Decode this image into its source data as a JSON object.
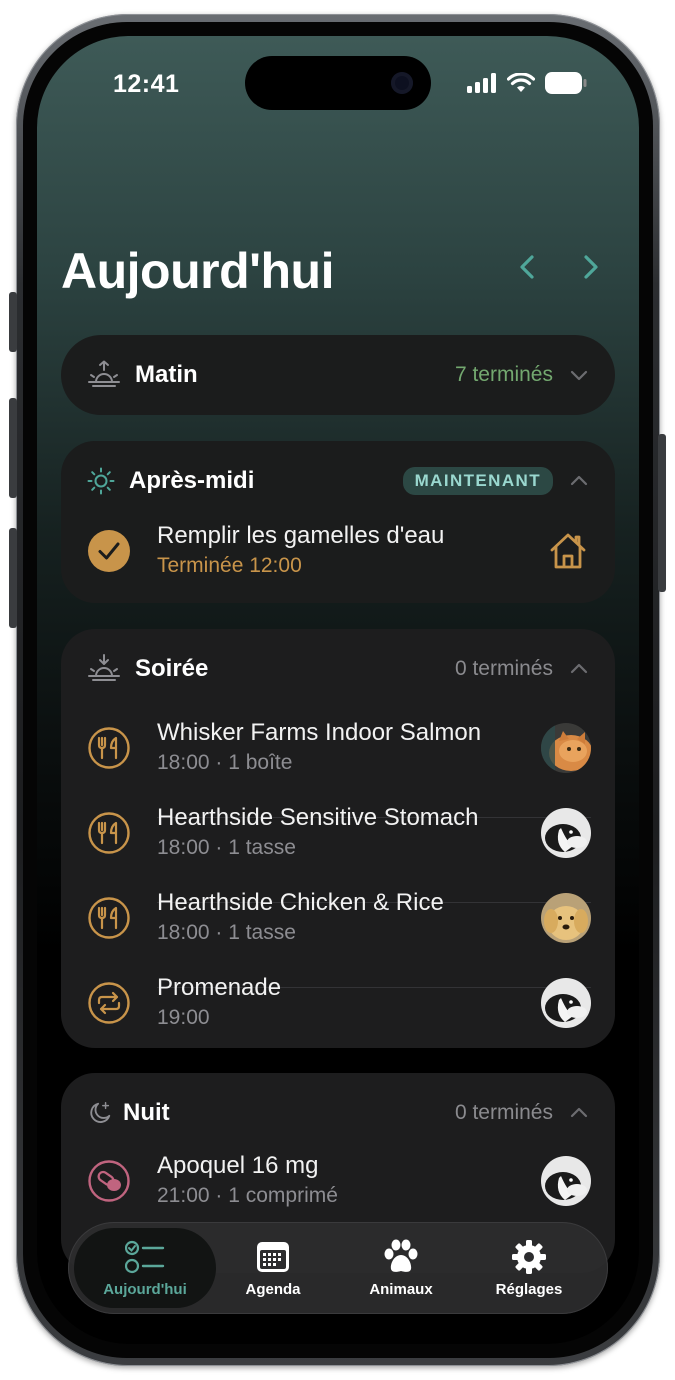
{
  "status_bar": {
    "time": "12:41"
  },
  "header": {
    "title": "Aujourd'hui"
  },
  "sections": {
    "matin": {
      "title": "Matin",
      "status": "7 terminés"
    },
    "aprem": {
      "title": "Après-midi",
      "badge": "MAINTENANT",
      "tasks": [
        {
          "title": "Remplir les gamelles d'eau",
          "subtitle": "Terminée 12:00"
        }
      ]
    },
    "soiree": {
      "title": "Soirée",
      "status": "0 terminés",
      "tasks": [
        {
          "title": "Whisker Farms Indoor Salmon",
          "subtitle": "18:00 · 1 boîte"
        },
        {
          "title": "Hearthside Sensitive Stomach",
          "subtitle": "18:00 · 1 tasse"
        },
        {
          "title": "Hearthside Chicken & Rice",
          "subtitle": "18:00 · 1 tasse"
        },
        {
          "title": "Promenade",
          "subtitle": "19:00"
        }
      ]
    },
    "nuit": {
      "title": "Nuit",
      "status": "0 terminés",
      "tasks": [
        {
          "title": "Apoquel 16 mg",
          "subtitle": "21:00 · 1 comprimé"
        }
      ]
    }
  },
  "tabbar": {
    "tabs": [
      {
        "label": "Aujourd'hui",
        "icon": "checklist-icon",
        "active": true
      },
      {
        "label": "Agenda",
        "icon": "calendar-icon"
      },
      {
        "label": "Animaux",
        "icon": "paw-icon"
      },
      {
        "label": "Réglages",
        "icon": "gear-icon"
      }
    ]
  },
  "colors": {
    "accent_teal": "#5ba79a",
    "accent_gold": "#c8944a",
    "done_green": "#73a86f",
    "medication_pink": "#c0647f"
  }
}
